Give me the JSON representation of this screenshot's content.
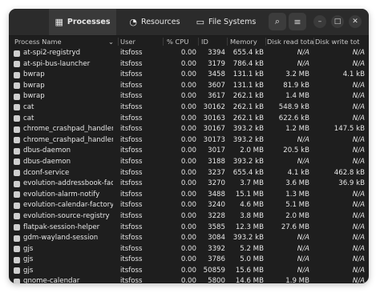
{
  "tabs": [
    {
      "label": "Processes",
      "icon": "processes-icon",
      "glyph": "▦",
      "active": true
    },
    {
      "label": "Resources",
      "icon": "resources-icon",
      "glyph": "◔",
      "active": false
    },
    {
      "label": "File Systems",
      "icon": "file-systems-icon",
      "glyph": "▭",
      "active": false
    }
  ],
  "header_buttons": {
    "search_glyph": "⌕",
    "menu_glyph": "≡"
  },
  "window_controls": {
    "minimize_glyph": "–",
    "maximize_glyph": "□",
    "close_glyph": "✕"
  },
  "columns": {
    "name": "Process Name",
    "sort_glyph": "⌄",
    "user": "User",
    "cpu": "% CPU",
    "id": "ID",
    "memory": "Memory",
    "disk_read": "Disk read tota",
    "disk_write": "Disk write tot"
  },
  "rows": [
    {
      "name": "at-spi2-registryd",
      "user": "itsfoss",
      "cpu": "0.00",
      "id": "3394",
      "memory": "655.4 kB",
      "read": "N/A",
      "write": "N/A"
    },
    {
      "name": "at-spi-bus-launcher",
      "user": "itsfoss",
      "cpu": "0.00",
      "id": "3179",
      "memory": "786.4 kB",
      "read": "N/A",
      "write": "N/A"
    },
    {
      "name": "bwrap",
      "user": "itsfoss",
      "cpu": "0.00",
      "id": "3458",
      "memory": "131.1 kB",
      "read": "3.2 MB",
      "write": "4.1 kB"
    },
    {
      "name": "bwrap",
      "user": "itsfoss",
      "cpu": "0.00",
      "id": "3607",
      "memory": "131.1 kB",
      "read": "81.9 kB",
      "write": "N/A"
    },
    {
      "name": "bwrap",
      "user": "itsfoss",
      "cpu": "0.00",
      "id": "3617",
      "memory": "262.1 kB",
      "read": "1.4 MB",
      "write": "N/A"
    },
    {
      "name": "cat",
      "user": "itsfoss",
      "cpu": "0.00",
      "id": "30162",
      "memory": "262.1 kB",
      "read": "548.9 kB",
      "write": "N/A"
    },
    {
      "name": "cat",
      "user": "itsfoss",
      "cpu": "0.00",
      "id": "30163",
      "memory": "262.1 kB",
      "read": "622.6 kB",
      "write": "N/A"
    },
    {
      "name": "chrome_crashpad_handler",
      "user": "itsfoss",
      "cpu": "0.00",
      "id": "30167",
      "memory": "393.2 kB",
      "read": "1.2 MB",
      "write": "147.5 kB"
    },
    {
      "name": "chrome_crashpad_handler",
      "user": "itsfoss",
      "cpu": "0.00",
      "id": "30173",
      "memory": "393.2 kB",
      "read": "N/A",
      "write": "N/A"
    },
    {
      "name": "dbus-daemon",
      "user": "itsfoss",
      "cpu": "0.00",
      "id": "3017",
      "memory": "2.0 MB",
      "read": "20.5 kB",
      "write": "N/A"
    },
    {
      "name": "dbus-daemon",
      "user": "itsfoss",
      "cpu": "0.00",
      "id": "3188",
      "memory": "393.2 kB",
      "read": "N/A",
      "write": "N/A"
    },
    {
      "name": "dconf-service",
      "user": "itsfoss",
      "cpu": "0.00",
      "id": "3237",
      "memory": "655.4 kB",
      "read": "4.1 kB",
      "write": "462.8 kB"
    },
    {
      "name": "evolution-addressbook-factory",
      "user": "itsfoss",
      "cpu": "0.00",
      "id": "3270",
      "memory": "3.7 MB",
      "read": "3.6 MB",
      "write": "36.9 kB"
    },
    {
      "name": "evolution-alarm-notify",
      "user": "itsfoss",
      "cpu": "0.00",
      "id": "3488",
      "memory": "15.1 MB",
      "read": "1.3 MB",
      "write": "N/A"
    },
    {
      "name": "evolution-calendar-factory",
      "user": "itsfoss",
      "cpu": "0.00",
      "id": "3240",
      "memory": "4.6 MB",
      "read": "5.1 MB",
      "write": "N/A"
    },
    {
      "name": "evolution-source-registry",
      "user": "itsfoss",
      "cpu": "0.00",
      "id": "3228",
      "memory": "3.8 MB",
      "read": "2.0 MB",
      "write": "N/A"
    },
    {
      "name": "flatpak-session-helper",
      "user": "itsfoss",
      "cpu": "0.00",
      "id": "3585",
      "memory": "12.3 MB",
      "read": "27.6 MB",
      "write": "N/A"
    },
    {
      "name": "gdm-wayland-session",
      "user": "itsfoss",
      "cpu": "0.00",
      "id": "3084",
      "memory": "393.2 kB",
      "read": "N/A",
      "write": "N/A"
    },
    {
      "name": "gjs",
      "user": "itsfoss",
      "cpu": "0.00",
      "id": "3392",
      "memory": "5.2 MB",
      "read": "N/A",
      "write": "N/A"
    },
    {
      "name": "gjs",
      "user": "itsfoss",
      "cpu": "0.00",
      "id": "3786",
      "memory": "5.0 MB",
      "read": "N/A",
      "write": "N/A"
    },
    {
      "name": "gjs",
      "user": "itsfoss",
      "cpu": "0.00",
      "id": "50859",
      "memory": "15.6 MB",
      "read": "N/A",
      "write": "N/A"
    },
    {
      "name": "gnome-calendar",
      "user": "itsfoss",
      "cpu": "0.00",
      "id": "5800",
      "memory": "14.6 MB",
      "read": "1.9 MB",
      "write": "N/A"
    }
  ]
}
